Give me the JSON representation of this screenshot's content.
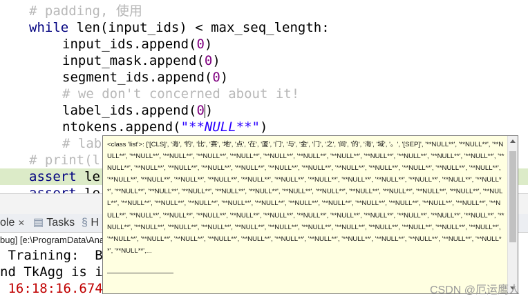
{
  "editor": {
    "lines": {
      "l1_comment": "# padding, 使用",
      "l2_kw": "while",
      "l2_rest": " len(input_ids) < max_seq_length:",
      "l3_call": "input_ids.append(",
      "l3_num": "0",
      "l3_close": ")",
      "l4_call": "input_mask.append(",
      "l4_num": "0",
      "l4_close": ")",
      "l5_call": "segment_ids.append(",
      "l5_num": "0",
      "l5_close": ")",
      "l6_comment": "# we don't concerned about it!",
      "l7_call": "label_ids.append(",
      "l7_num": "0",
      "l7_close": ")",
      "l8_call": "ntokens.append(",
      "l8_str": "\"**NULL**\"",
      "l8_close": ")",
      "l9_comment": "# lab",
      "l10_comment": "# print(l",
      "l11_kw": "assert",
      "l11_rest": " le",
      "l12_kw": "assert",
      "l12_rest": " le"
    }
  },
  "console": {
    "tabs": [
      "ole",
      "Tasks",
      "H"
    ],
    "path": "bug] [e:\\ProgramData\\Anac",
    "line1": " Training:  B",
    "line2": "nd TkAgg is i",
    "line3": " 16:18:16.674"
  },
  "tooltip": {
    "text": "<class 'list'>: ['[CLS]', '海', '钓', '比', '赛', '地', '点', '在', '厦', '门', '与', '金', '门', '之', '间', '的', '海', '域', '。', '[SEP]', '**NULL**', '**NULL**', '**NULL**', '**NULL**', '**NULL**', '**NULL**', '**NULL**', '**NULL**', '**NULL**', '**NULL**', '**NULL**', '**NULL**', '**NULL**', '**NULL**', '**NULL**', '**NULL**', '**NULL**', '**NULL**', '**NULL**', '**NULL**', '**NULL**', '**NULL**', '**NULL**', '**NULL**', '**NULL**', '**NULL**', '**NULL**', '**NULL**', '**NULL**', '**NULL**', '**NULL**', '**NULL**', '**NULL**', '**NULL**', '**NULL**', '**NULL**', '**NULL**', '**NULL**', '**NULL**', '**NULL**', '**NULL**', '**NULL**', '**NULL**', '**NULL**', '**NULL**', '**NULL**', '**NULL**', '**NULL**', '**NULL**', '**NULL**', '**NULL**', '**NULL**', '**NULL**', '**NULL**', '**NULL**', '**NULL**', '**NULL**', '**NULL**', '**NULL**', '**NULL**', '**NULL**', '**NULL**', '**NULL**', '**NULL**', '**NULL**', '**NULL**', '**NULL**', '**NULL**', '**NULL**', '**NULL**', '**NULL**', '**NULL**', '**NULL**', '**NULL**', '**NULL**', '**NULL**', '**NULL**', '**NULL**', '**NULL**', '**NULL**', '**NULL**', '**NULL**', '**NULL**', '**NULL**', '**NULL**', '**NULL**', '**NULL**', '**NULL**', '**NULL**', '**NULL**', '**NULL**', '**NULL**', '**NULL**', '**NULL**', '**NULL**', '**NULL**', '**NULL**', '**NULL**',..."
  },
  "watermark": "CSDN @厄运鹰人"
}
